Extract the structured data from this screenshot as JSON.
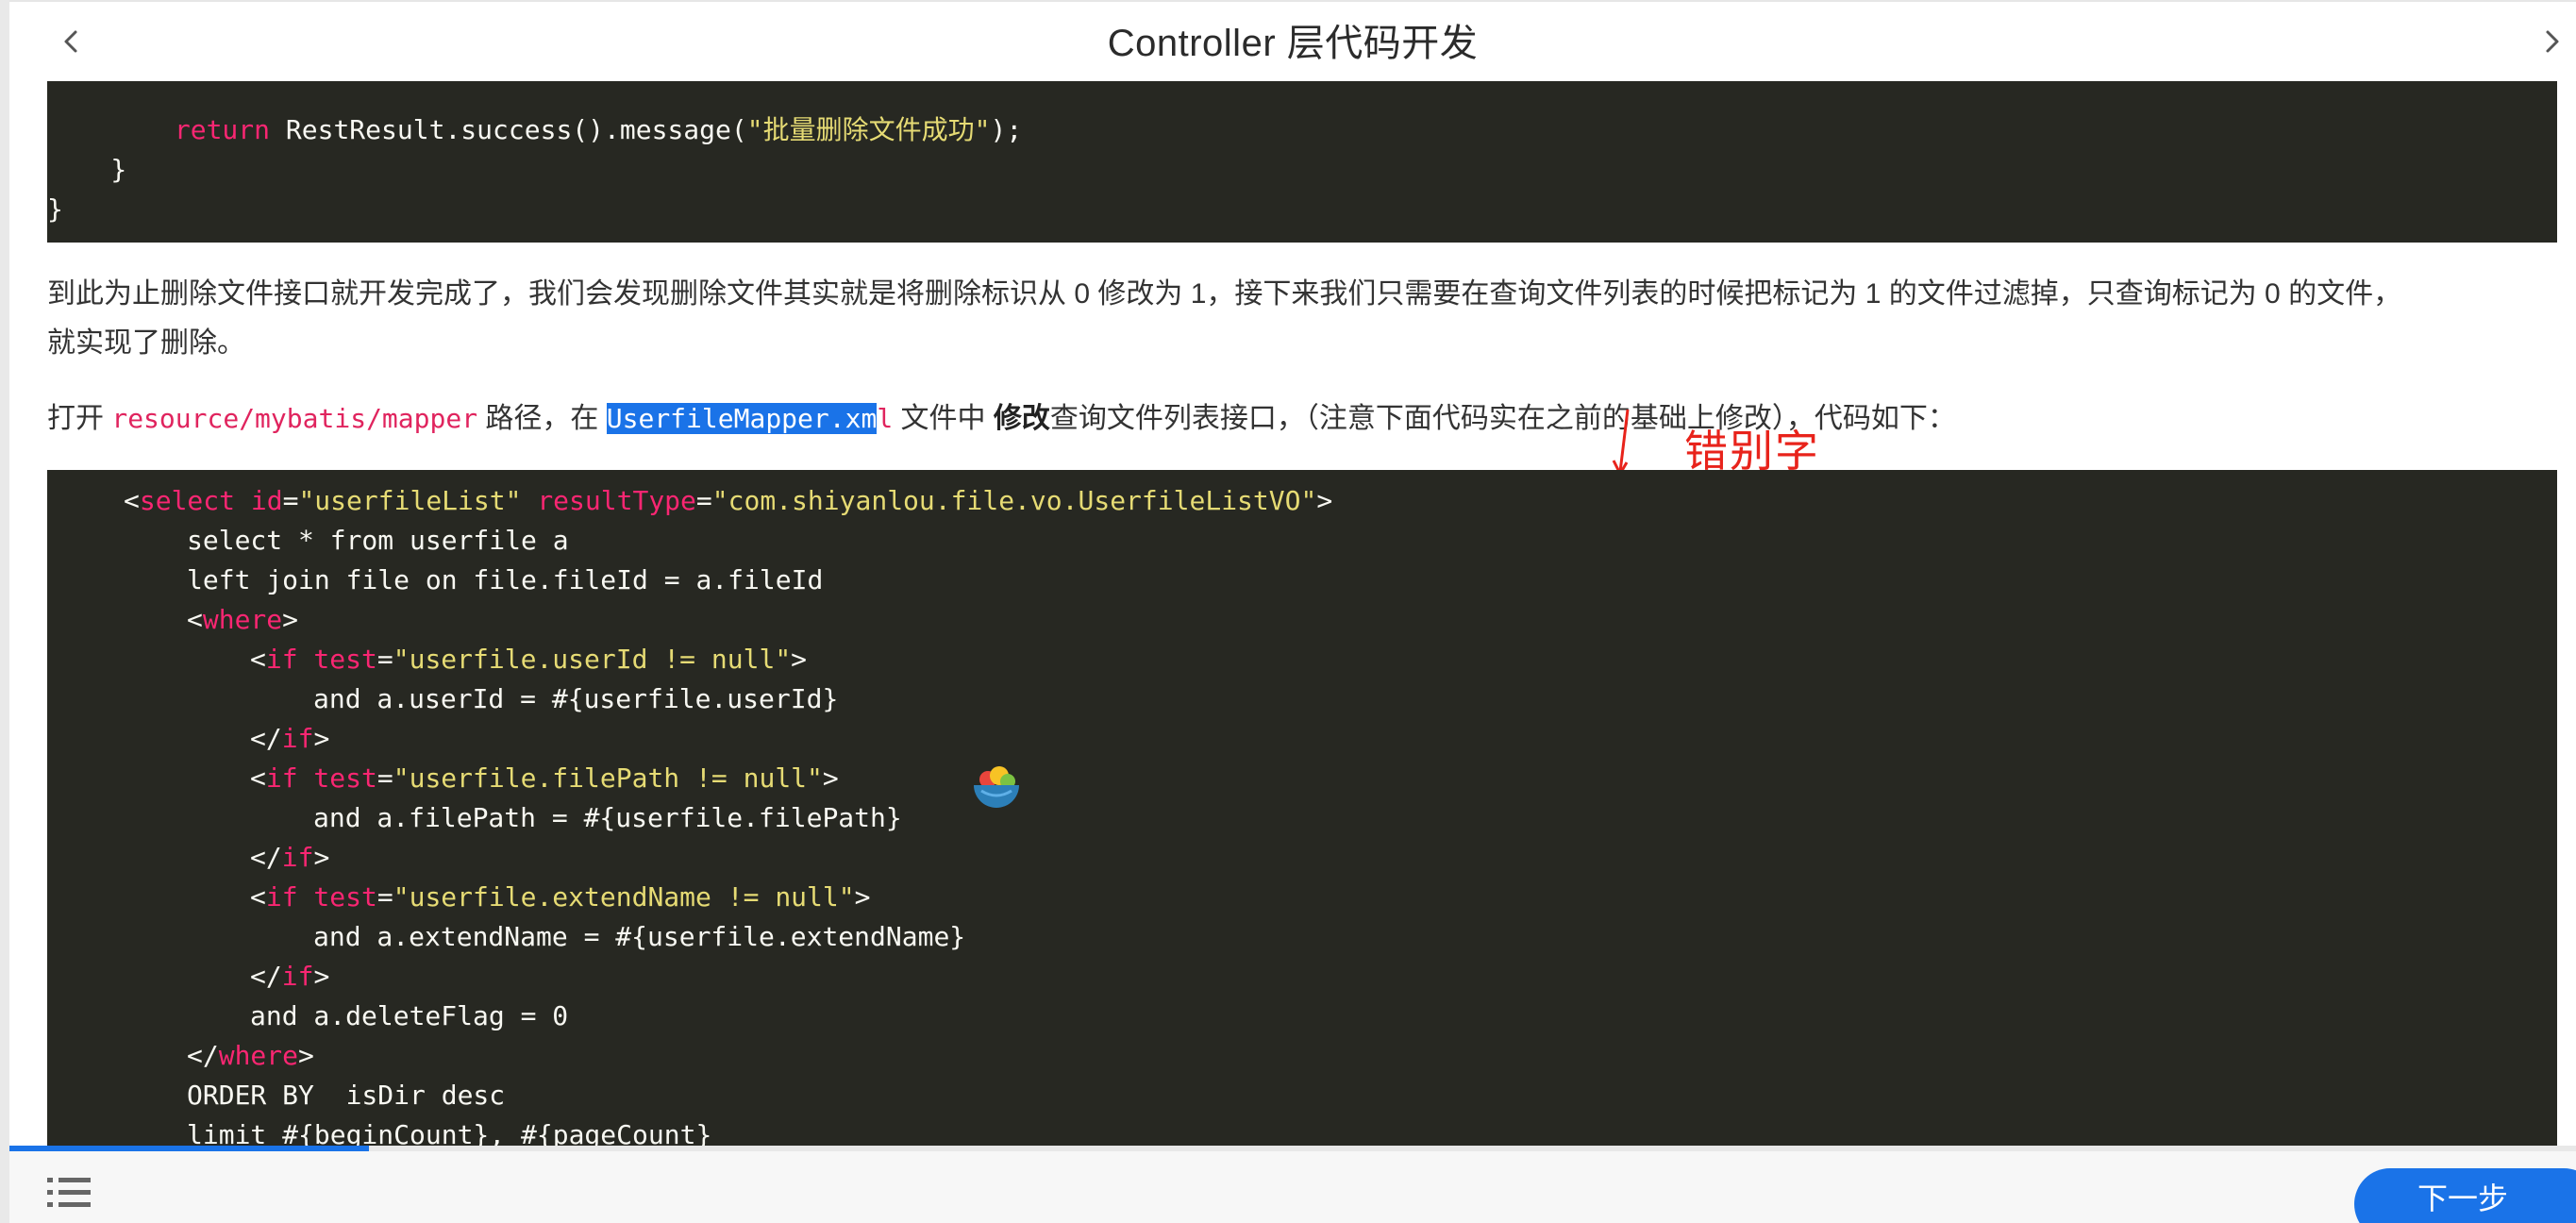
{
  "header": {
    "title": "Controller 层代码开发",
    "prev_icon": "chevron-left-icon",
    "next_icon": "chevron-right-icon"
  },
  "code_block_1": {
    "lines": [
      {
        "indent": "        ",
        "kw": "return",
        "rest_a": " RestResult.success().message(",
        "str": "\"批量删除文件成功\"",
        "rest_b": ");"
      },
      {
        "text": "    }"
      },
      {
        "text": "}"
      }
    ]
  },
  "paragraph_1": {
    "line_1": "到此为止删除文件接口就开发完成了，我们会发现删除文件其实就是将删除标识从 0 修改为 1，接下来我们只需要在查询文件列表的时候把标记为 1 的文件过滤掉，只查询标记为 0 的文件，",
    "line_2": "就实现了删除。"
  },
  "annotation": {
    "label": "错别字",
    "color": "#e8231b"
  },
  "paragraph_2": {
    "prefix": "打开 ",
    "path_code": "resource/mybatis/mapper",
    "mid_1": " 路径，在 ",
    "file_code_selected": "UserfileMapper.xm",
    "file_code_rest": "l",
    "mid_2": " 文件中 ",
    "bold": "修改",
    "suffix": "查询文件列表接口，（注意下面代码实在之前的基础上修改），代码如下："
  },
  "code_block_2": {
    "l1_open": "<",
    "l1_tag": "select",
    "l1_attr1": " id",
    "l1_eq1": "=",
    "l1_val1": "\"userfileList\"",
    "l1_attr2": " resultType",
    "l1_eq2": "=",
    "l1_val2": "\"com.shiyanlou.file.vo.UserfileListVO\"",
    "l1_close": ">",
    "l2": "select * from userfile a",
    "l3": "left join file on file.fileId = a.fileId",
    "l4_open": "<",
    "l4_tag": "where",
    "l4_close": ">",
    "l5_open": "<",
    "l5_tag": "if",
    "l5_attr": " test",
    "l5_eq": "=",
    "l5_val": "\"userfile.userId != null\"",
    "l5_close": ">",
    "l6": "and a.userId = #{userfile.userId}",
    "l7_open": "</",
    "l7_tag": "if",
    "l7_close": ">",
    "l8_open": "<",
    "l8_tag": "if",
    "l8_attr": " test",
    "l8_eq": "=",
    "l8_val": "\"userfile.filePath != null\"",
    "l8_close": ">",
    "l9": "and a.filePath = #{userfile.filePath}",
    "l10_open": "</",
    "l10_tag": "if",
    "l10_close": ">",
    "l11_open": "<",
    "l11_tag": "if",
    "l11_attr": " test",
    "l11_eq": "=",
    "l11_val": "\"userfile.extendName != null\"",
    "l11_close": ">",
    "l12": "and a.extendName = #{userfile.extendName}",
    "l13_open": "</",
    "l13_tag": "if",
    "l13_close": ">",
    "l14": "and a.deleteFlag = 0",
    "l15_open": "</",
    "l15_tag": "where",
    "l15_close": ">",
    "l16": "ORDER BY  isDir desc",
    "l17": "limit #{beginCount}, #{pageCount}"
  },
  "footer": {
    "toc_icon": "list-icon",
    "next_label": "下一步",
    "progress": 0.14
  },
  "floating_widget": {
    "icon": "bowl-icon"
  },
  "colors": {
    "code_bg": "#272822",
    "keyword": "#f92672",
    "string": "#e6db74",
    "inline_code": "#e0245e",
    "accent": "#1a73e8",
    "annotation": "#e8231b"
  }
}
